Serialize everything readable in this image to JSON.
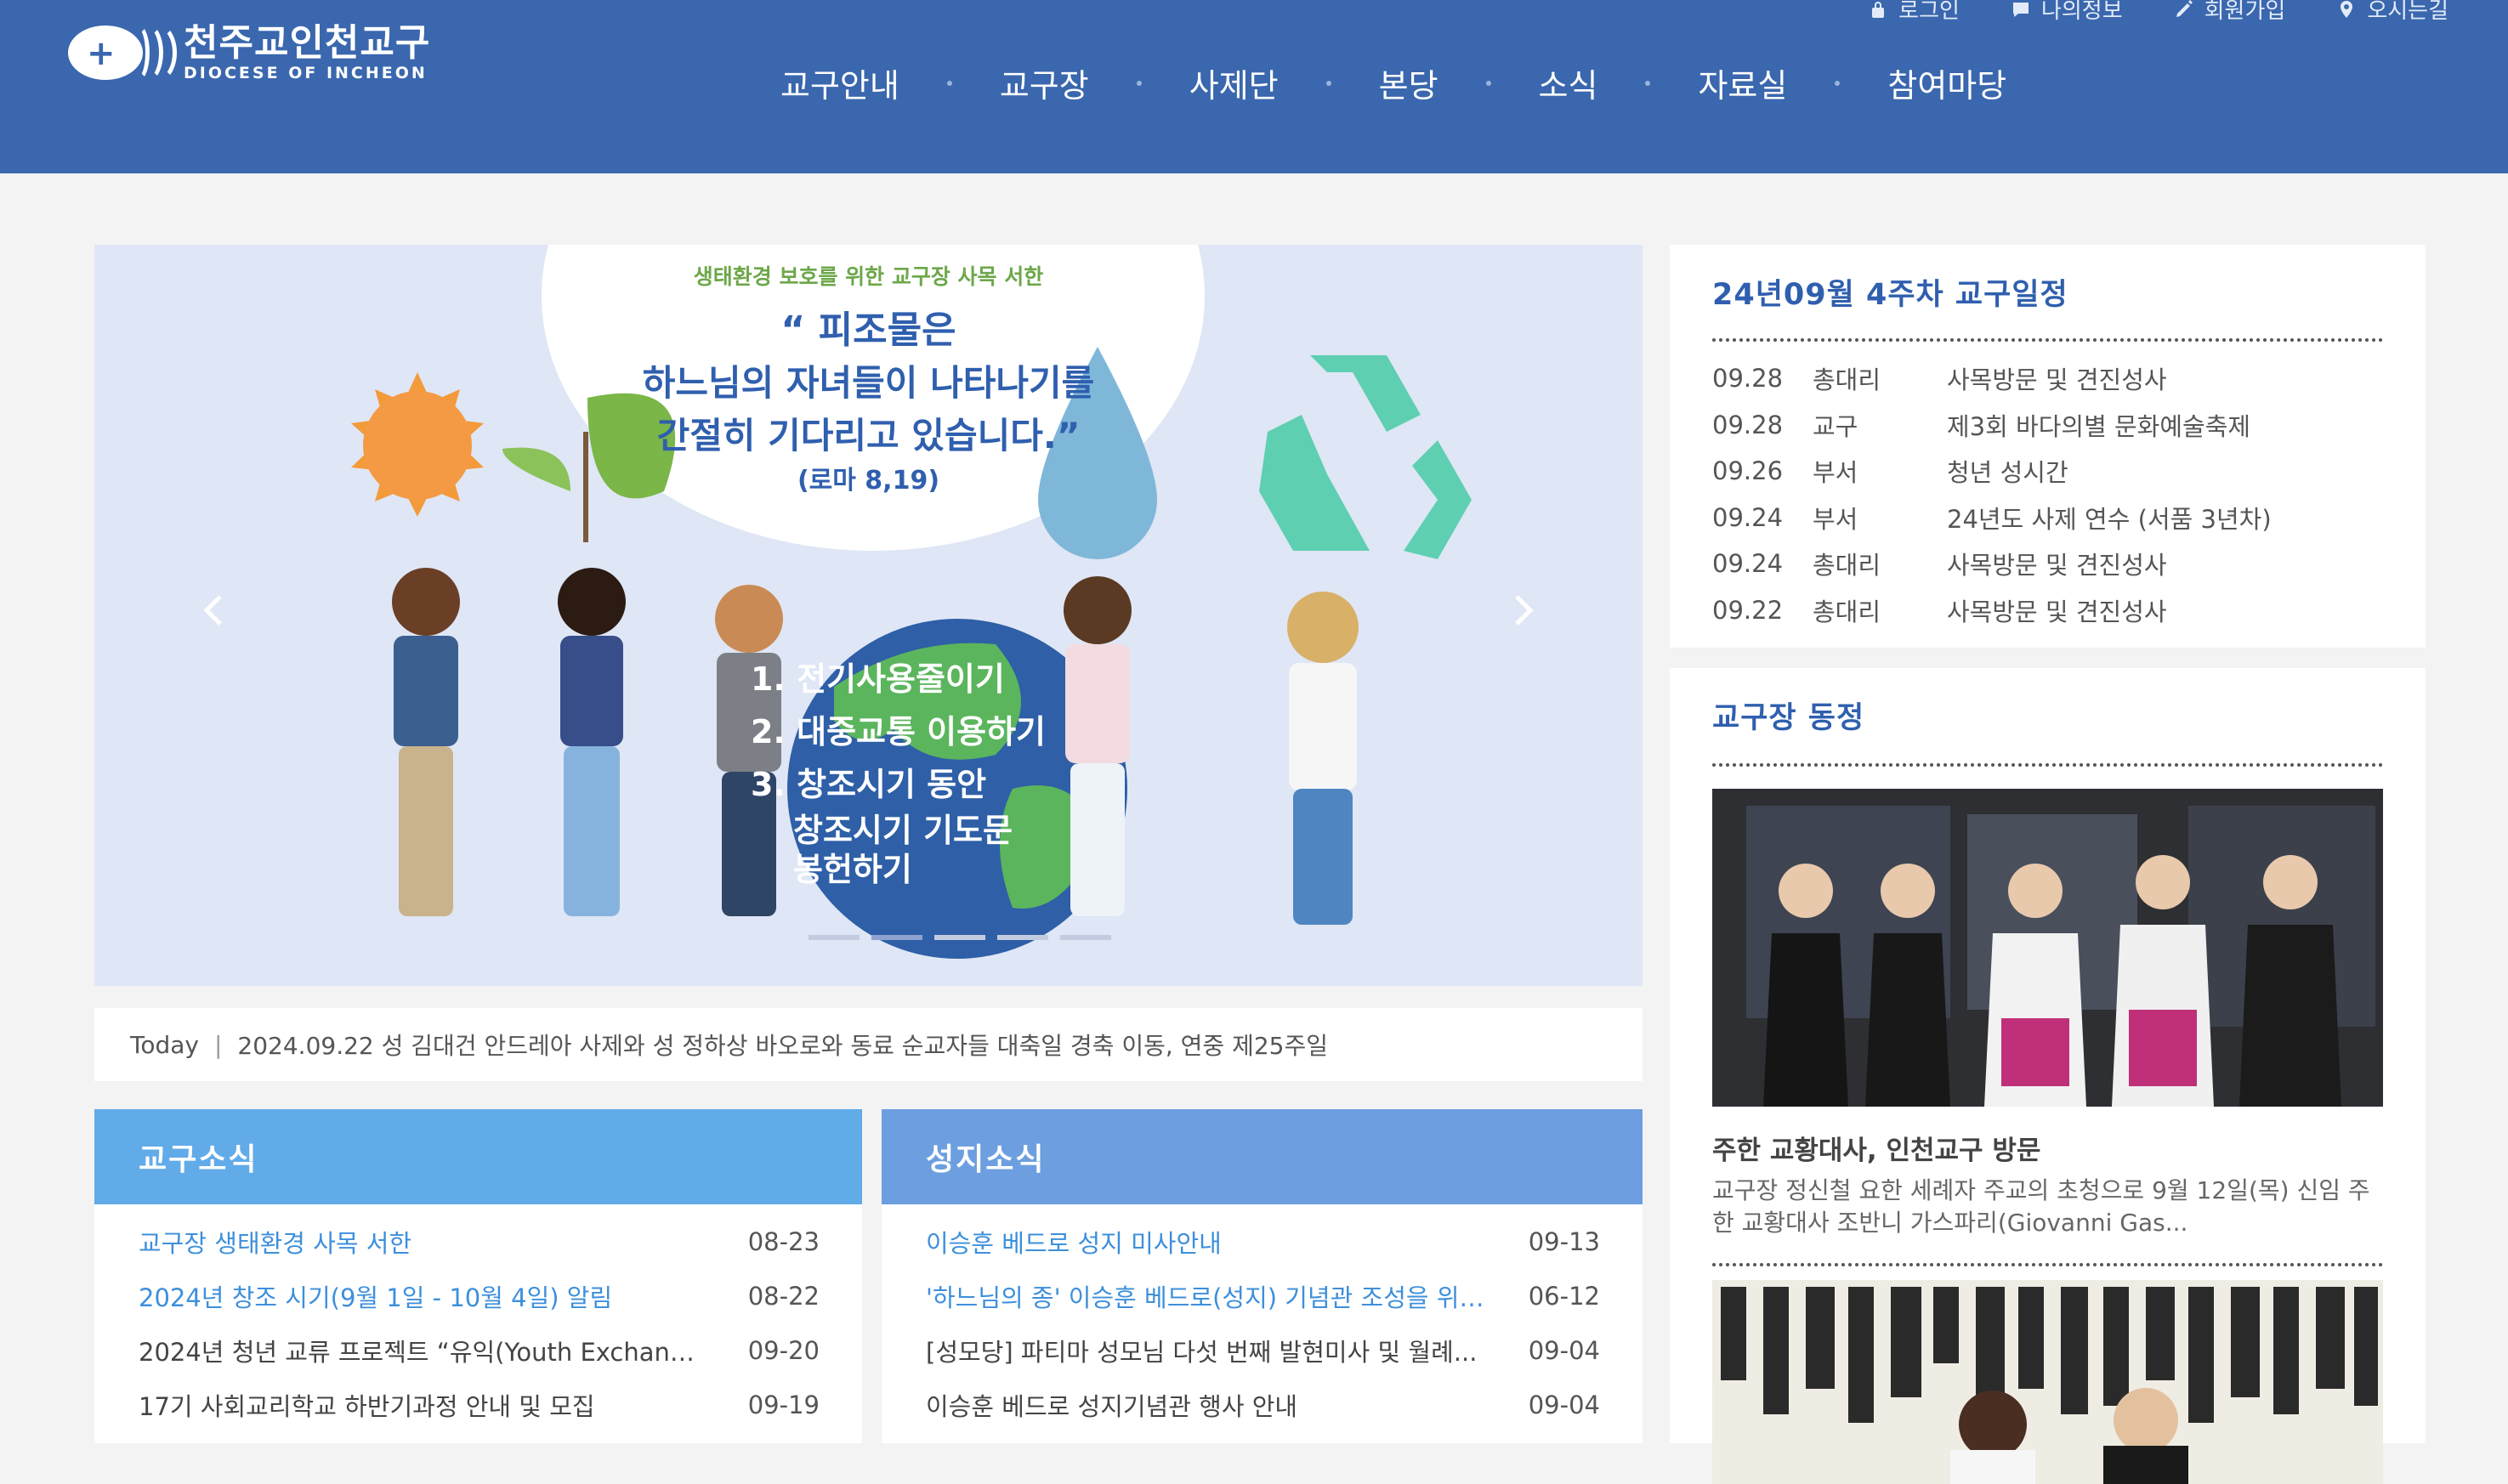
{
  "header": {
    "logo_ko": "천주교인천교구",
    "logo_en": "DIOCESE OF INCHEON",
    "util": [
      {
        "label": "로그인",
        "icon": "lock-icon"
      },
      {
        "label": "나의정보",
        "icon": "chat-icon"
      },
      {
        "label": "회원가입",
        "icon": "pencil-icon"
      },
      {
        "label": "오시는길",
        "icon": "map-pin-icon"
      }
    ],
    "nav": [
      "교구안내",
      "교구장",
      "사제단",
      "본당",
      "소식",
      "자료실",
      "참여마당"
    ],
    "bg_color": "#3a67ae"
  },
  "slider": {
    "subtitle": "생태환경 보호를 위한 교구장 사목 서한",
    "quote_line1": "“ 피조물은",
    "quote_line2": "하느님의 자녀들이 나타나기를",
    "quote_line3": "간절히 기다리고 있습니다.”",
    "quote_ref": "(로마 8,19)",
    "list_1": "1. 전기사용줄이기",
    "list_2": "2. 대중교통 이용하기",
    "list_3a": "3. 창조시기 동안",
    "list_3b": "창조시기 기도문",
    "list_3c": "봉헌하기",
    "slide_count": 5,
    "active_slide": 2
  },
  "today": {
    "label": "Today",
    "text": "2024.09.22 성 김대건 안드레아 사제와 성 정하상 바오로와 동료 순교자들 대축일 경축 이동, 연중 제25주일"
  },
  "diocese_news": {
    "title": "교구소식",
    "head_color": "#62abe9",
    "items": [
      {
        "title": "교구장 생태환경 사목 서한",
        "date": "08-23",
        "highlight": true
      },
      {
        "title": "2024년 창조 시기(9월 1일 - 10월 4일) 알림",
        "date": "08-22",
        "highlight": true
      },
      {
        "title": "2024년 청년 교류 프로젝트 “유익(Youth Exchange...",
        "date": "09-20",
        "highlight": false
      },
      {
        "title": "17기 사회교리학교 하반기과정 안내 및 모집",
        "date": "09-19",
        "highlight": false
      }
    ]
  },
  "shrine_news": {
    "title": "성지소식",
    "head_color": "#6d9fe0",
    "items": [
      {
        "title": "이승훈 베드로 성지 미사안내",
        "date": "09-13",
        "highlight": true
      },
      {
        "title": "'하느님의 종' 이승훈 베드로(성지) 기념관 조성을 위한...",
        "date": "06-12",
        "highlight": true
      },
      {
        "title": "[성모당] 파티마 성모님 다섯 번째 발현미사 및 월례...",
        "date": "09-04",
        "highlight": false
      },
      {
        "title": "이승훈 베드로 성지기념관 행사 안내",
        "date": "09-04",
        "highlight": false
      }
    ]
  },
  "schedule": {
    "title": "24년09월 4주차 교구일정",
    "rows": [
      {
        "date": "09.28",
        "who": "총대리",
        "event": "사목방문 및 견진성사"
      },
      {
        "date": "09.28",
        "who": "교구",
        "event": "제3회 바다의별 문화예술축제"
      },
      {
        "date": "09.26",
        "who": "부서",
        "event": "청년 성시간"
      },
      {
        "date": "09.24",
        "who": "부서",
        "event": "24년도 사제 연수 (서품 3년차)"
      },
      {
        "date": "09.24",
        "who": "총대리",
        "event": "사목방문 및 견진성사"
      },
      {
        "date": "09.22",
        "who": "총대리",
        "event": "사목방문 및 견진성사"
      }
    ]
  },
  "bishop_news": {
    "title": "교구장 동정",
    "item_title": "주한 교황대사, 인천교구 방문",
    "item_desc": "교구장 정신철 요한 세례자 주교의 초청으로 9월 12일(목) 신임 주한 교황대사 조반니 가스파리(Giovanni Gas..."
  }
}
